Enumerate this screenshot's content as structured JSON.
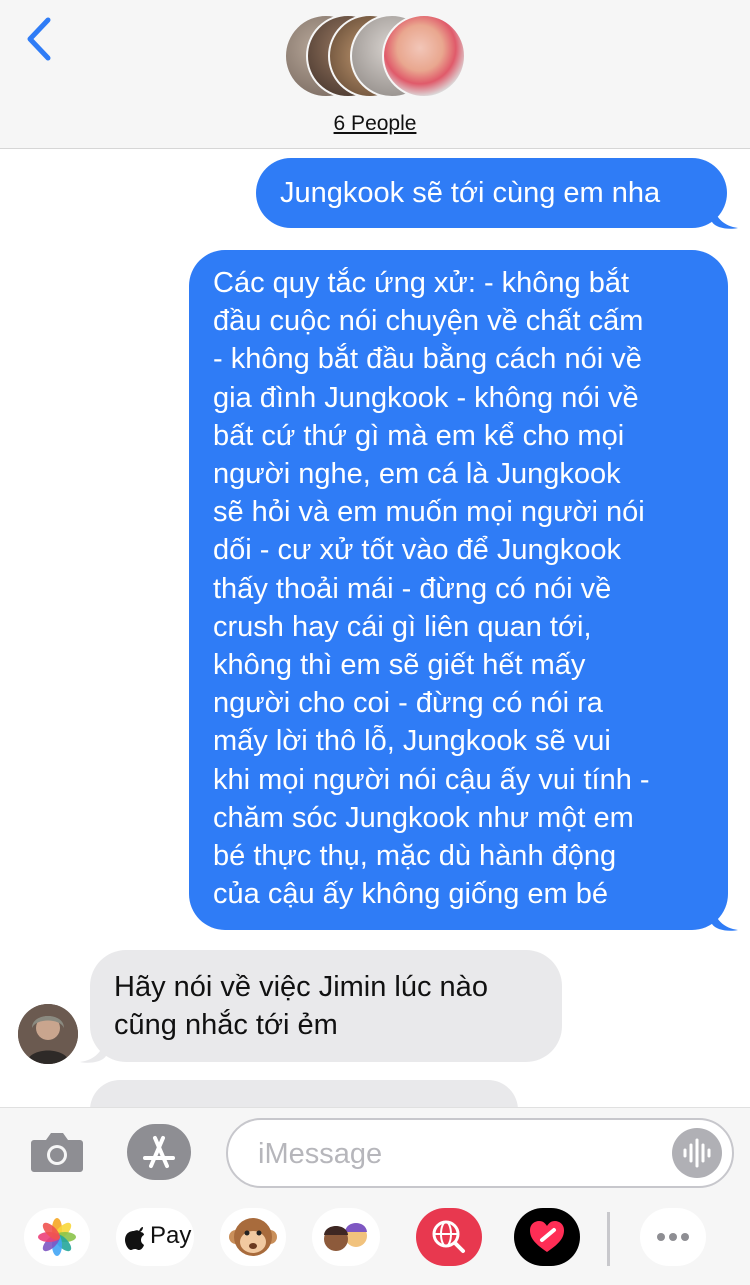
{
  "header": {
    "group_title": "6 People"
  },
  "messages": [
    {
      "direction": "outgoing",
      "text": "Jungkook sẽ tới cùng em nha"
    },
    {
      "direction": "outgoing",
      "lines": [
        "Các quy tắc ứng xử:  - không bắt",
        "đầu cuộc nói chuyện về chất cấm",
        "- không bắt đầu bằng cách nói về",
        "gia đình Jungkook - không nói về",
        "bất cứ thứ gì mà em kể cho mọi",
        "người nghe, em cá là Jungkook",
        "sẽ hỏi và em muốn mọi người nói",
        "dối - cư xử tốt vào để Jungkook",
        "thấy thoải mái - đừng có nói về",
        "crush hay cái gì liên quan tới,",
        "không thì em sẽ giết hết mấy",
        "người cho coi - đừng có nói ra",
        "mấy lời thô lỗ, Jungkook sẽ vui",
        "khi mọi người nói cậu ấy vui tính -",
        "chăm sóc Jungkook như một em",
        "bé thực thụ, mặc dù hành động",
        "của cậu ấy không giống em bé"
      ]
    },
    {
      "direction": "incoming",
      "lines": [
        "Hãy nói về việc Jimin lúc nào",
        "cũng nhắc tới ẻm"
      ]
    }
  ],
  "composer": {
    "placeholder": "iMessage"
  },
  "app_drawer": {
    "items": [
      "photos-icon",
      "Pay",
      "animoji-icon",
      "memoji-icon",
      "web-search-icon",
      "digital-touch-icon",
      "more-icon"
    ]
  },
  "colors": {
    "outgoing_bubble": "#2f7cf6",
    "incoming_bubble": "#e9e9eb",
    "header_bg": "#f6f6f6"
  }
}
